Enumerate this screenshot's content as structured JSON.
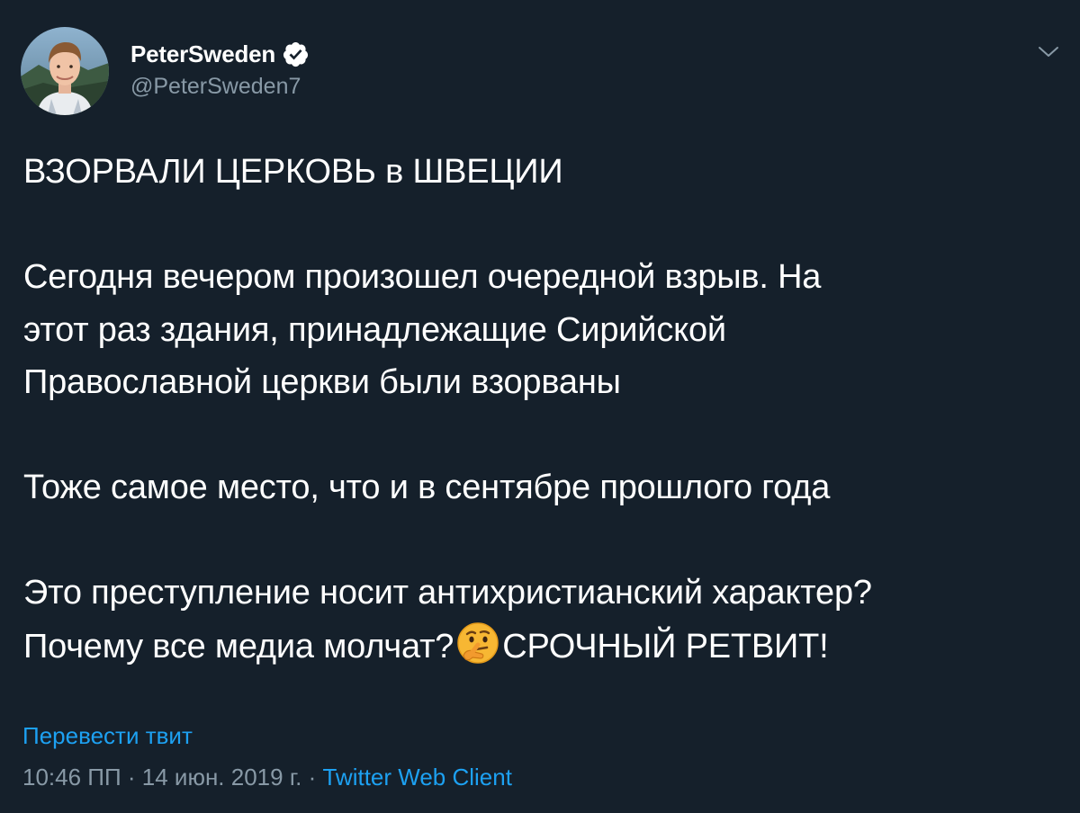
{
  "author": {
    "display_name": "PeterSweden",
    "handle": "@PeterSweden7",
    "verified_icon": "verified-badge-icon",
    "avatar_icon": "avatar-photo"
  },
  "menu": {
    "icon": "chevron-down-icon"
  },
  "tweet": {
    "line1": "ВЗОРВАЛИ ЦЕРКОВЬ в ШВЕЦИИ",
    "line2": "Сегодня вечером произошел очередной взрыв. На",
    "line3": "этот раз здания, принадлежащие Сирийской",
    "line4": "Православной церкви были взорваны",
    "line5": "Тоже самое место, что и в сентябре прошлого года",
    "line6": "Это преступление носит антихристианский характер?",
    "line7_before": "Почему все медиа молчат?",
    "line7_emoji": "🤔",
    "line7_after": "СРОЧНЫЙ РЕТВИТ!"
  },
  "translate_label": "Перевести твит",
  "meta": {
    "time": "10:46 ПП",
    "sep1": " · ",
    "date": "14 июн. 2019 г.",
    "sep2": " · ",
    "client": "Twitter Web Client"
  },
  "colors": {
    "background": "#15202b",
    "text": "#ffffff",
    "secondary": "#8899a6",
    "accent": "#1da1f2"
  }
}
